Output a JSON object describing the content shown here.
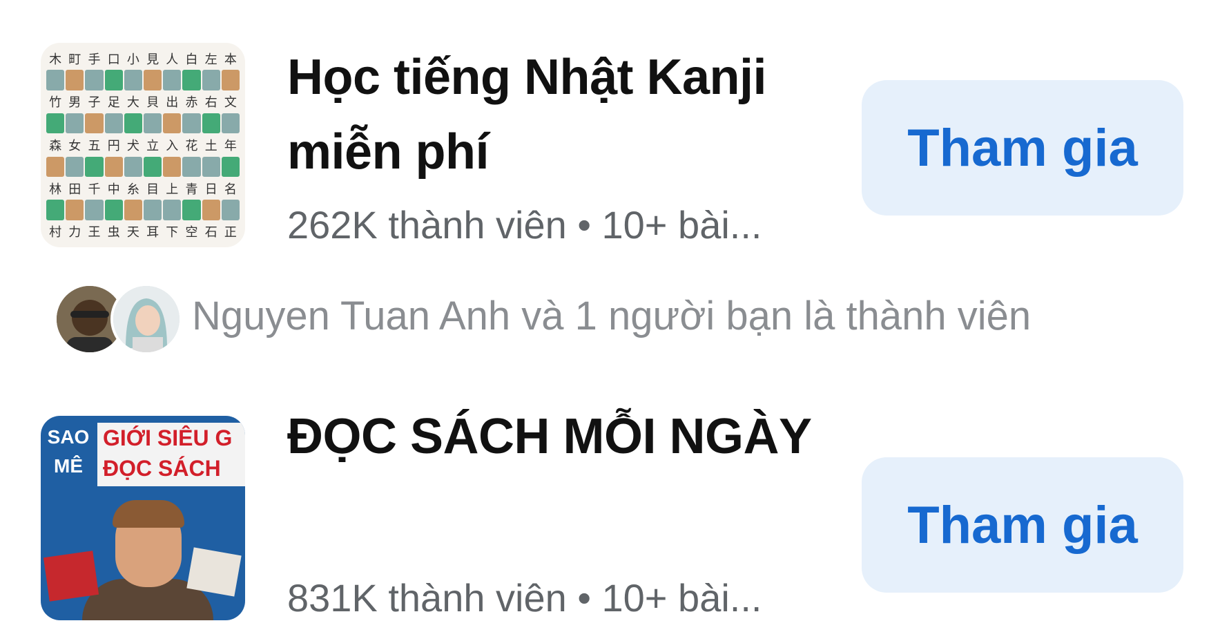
{
  "groups": [
    {
      "title": "Học tiếng Nhật Kanji miễn phí",
      "meta": "262K thành viên • 10+ bài...",
      "join_label": "Tham gia",
      "thumbnail_icon": "kanji-chart-image"
    },
    {
      "title": "ĐỌC SÁCH MỖI NGÀY",
      "meta": "831K thành viên • 10+ bài...",
      "join_label": "Tham gia",
      "thumbnail_icon": "reading-person-image",
      "thumbnail_text": {
        "left_top": "SAO",
        "left_bottom": "MÊ",
        "right_top": "GIỚI SIÊU G",
        "right_bottom": "ĐỌC SÁCH"
      }
    }
  ],
  "friends": {
    "text": "Nguyen Tuan Anh và 1 người bạn là thành viên"
  },
  "colors": {
    "button_bg": "#e6f0fb",
    "button_text": "#1769d0",
    "meta_text": "#606468",
    "friends_text": "#8a8d91"
  }
}
